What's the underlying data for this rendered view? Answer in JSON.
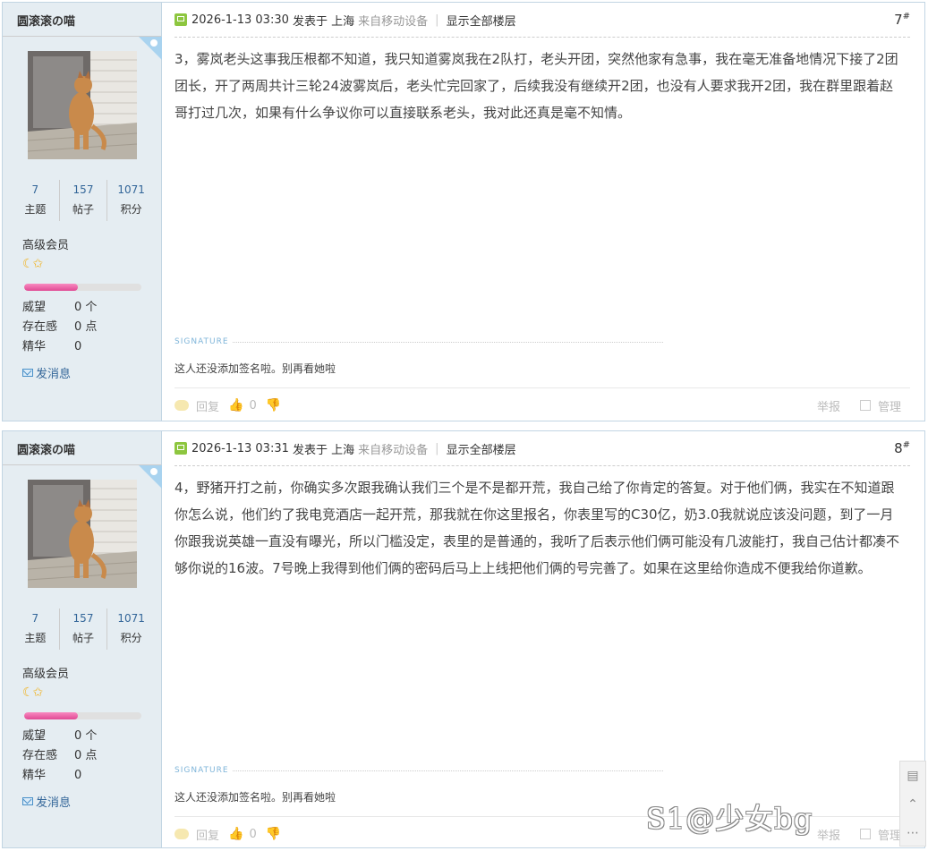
{
  "posts": [
    {
      "author": "圆滚滚の喵",
      "stats": [
        {
          "num": "7",
          "label": "主题"
        },
        {
          "num": "157",
          "label": "帖子"
        },
        {
          "num": "1071",
          "label": "积分"
        }
      ],
      "group": "高级会员",
      "level_icons": "☾✩",
      "progress": 0.46,
      "props": [
        {
          "k": "威望",
          "v": "0 个"
        },
        {
          "k": "存在感",
          "v": "0 点"
        },
        {
          "k": "精华",
          "v": "0"
        }
      ],
      "send_message": "发消息",
      "time": "2026-1-13 03:30",
      "posted_from": "发表于 上海",
      "mobile": "来自移动设备",
      "show_all": "显示全部楼层",
      "floor": "7",
      "content": "3，雾岚老头这事我压根都不知道，我只知道雾岚我在2队打，老头开团，突然他家有急事，我在毫无准备地情况下接了2团团长，开了两周共计三轮24波雾岚后，老头忙完回家了，后续我没有继续开2团，也没有人要求我开2团，我在群里跟着赵哥打过几次，如果有什么争议你可以直接联系老头，我对此还真是毫不知情。",
      "signature_label": "SIGNATURE",
      "signature": "这人还没添加签名啦。别再看她啦",
      "reply": "回复",
      "likes": "0",
      "report": "举报",
      "manage": "管理"
    },
    {
      "author": "圆滚滚の喵",
      "stats": [
        {
          "num": "7",
          "label": "主题"
        },
        {
          "num": "157",
          "label": "帖子"
        },
        {
          "num": "1071",
          "label": "积分"
        }
      ],
      "group": "高级会员",
      "level_icons": "☾✩",
      "progress": 0.46,
      "props": [
        {
          "k": "威望",
          "v": "0 个"
        },
        {
          "k": "存在感",
          "v": "0 点"
        },
        {
          "k": "精华",
          "v": "0"
        }
      ],
      "send_message": "发消息",
      "time": "2026-1-13 03:31",
      "posted_from": "发表于 上海",
      "mobile": "来自移动设备",
      "show_all": "显示全部楼层",
      "floor": "8",
      "content": "4，野猪开打之前，你确实多次跟我确认我们三个是不是都开荒，我自己给了你肯定的答复。对于他们俩，我实在不知道跟你怎么说，他们约了我电竞酒店一起开荒，那我就在你这里报名，你表里写的C30亿，奶3.0我就说应该没问题，到了一月你跟我说英雄一直没有曝光，所以门槛没定，表里的是普通的，我听了后表示他们俩可能没有几波能打，我自己估计都凑不够你说的16波。7号晚上我得到他们俩的密码后马上上线把他们俩的号完善了。如果在这里给你造成不便我给你道歉。",
      "signature_label": "SIGNATURE",
      "signature": "这人还没添加签名啦。别再看她啦",
      "reply": "回复",
      "likes": "0",
      "report": "举报",
      "manage": "管理"
    }
  ],
  "watermark": "S1@少女bg",
  "floating_tools": [
    "comment-icon",
    "back-to-top-icon",
    "more-icon"
  ]
}
